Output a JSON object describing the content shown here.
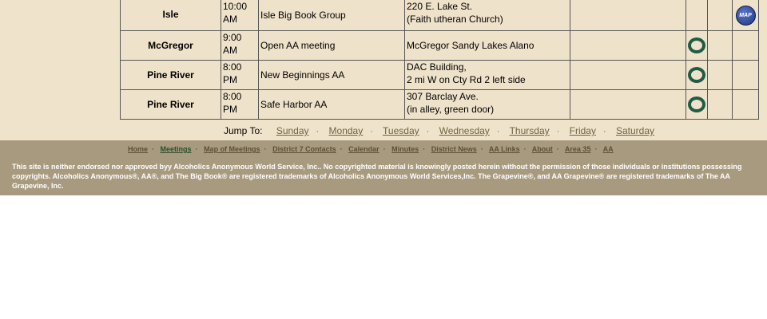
{
  "meetings": [
    {
      "city": "Isle",
      "time": [
        "10:00",
        "AM"
      ],
      "name": "Isle Big Book Group",
      "address": [
        "220 E. Lake St.",
        "(Faith utheran Church)"
      ],
      "open_badge": false,
      "map_badge": true
    },
    {
      "city": "McGregor",
      "time": [
        "9:00",
        "AM"
      ],
      "name": "Open AA meeting",
      "address": [
        "McGregor Sandy Lakes Alano",
        ""
      ],
      "open_badge": true,
      "map_badge": false
    },
    {
      "city": "Pine River",
      "time": [
        "8:00",
        "PM"
      ],
      "name": "New Beginnings AA",
      "address": [
        "DAC Building,",
        "2 mi W on Cty Rd 2 left side"
      ],
      "open_badge": true,
      "map_badge": false
    },
    {
      "city": "Pine River",
      "time": [
        "8:00",
        "PM"
      ],
      "name": "Safe Harbor AA",
      "address": [
        "307 Barclay Ave.",
        "(in alley, green door)"
      ],
      "open_badge": true,
      "map_badge": false
    }
  ],
  "badges": {
    "map_label": "MAP"
  },
  "jump": {
    "label": "Jump To:",
    "days": [
      " Sunday",
      "Monday",
      "Tuesday",
      "Wednesday",
      "Thursday",
      "Friday",
      "Saturday"
    ],
    "separator": "·"
  },
  "footer": {
    "nav": [
      "Home",
      "Meetings",
      "Map of Meetings",
      "District 7 Contacts",
      "Calendar",
      "Minutes",
      "District News",
      "AA Links",
      "About",
      "Area 35",
      "AA"
    ],
    "nav_separator": "·",
    "disclaimer": "This site is neither endorsed nor approved byy Alcoholics Anonymous World Service, Inc.. No copyrighted material is knowingly posted herein without the permission of those individuals or institutions possessing copyrights. Alcoholics Anonymous®, AA®, and The Big Book® are registered trademarks of Alcoholics Anonymous World Services,Inc. The Grapevine®, and AA Grapevine® are registered trademarks of The AA Grapevine, Inc."
  },
  "colors": {
    "page_bg": "#f0e3cb",
    "footer_bg": "#a89a7f",
    "link": "#6c6342",
    "badge_green": "#1f5c46",
    "badge_blue": "#1f3580"
  }
}
